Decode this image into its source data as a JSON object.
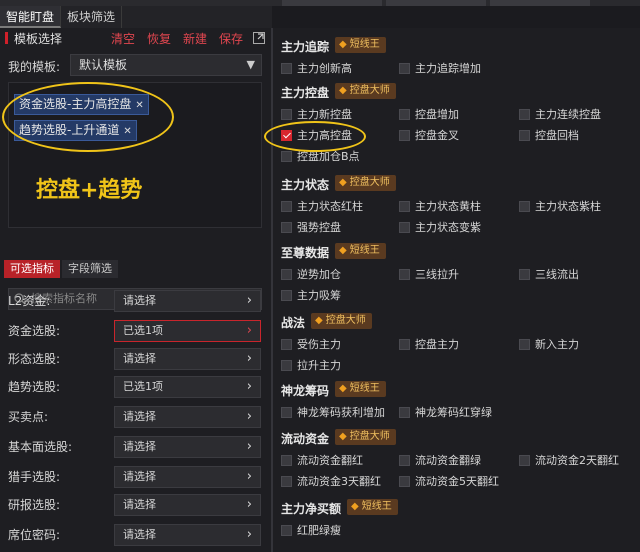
{
  "tabs": [
    "智能盯盘",
    "板块筛选"
  ],
  "left": {
    "header": {
      "title": "模板选择",
      "actions": [
        "清空",
        "恢复",
        "新建",
        "保存"
      ]
    },
    "my_template_label": "我的模板:",
    "template_value": "默认模板",
    "tags": [
      "资金选股-主力高控盘",
      "趋势选股-上升通道"
    ],
    "annotation": "控盘+趋势",
    "subtabs": [
      "可选指标",
      "字段筛选"
    ],
    "search_placeholder": "搜索指标名称",
    "filters": [
      {
        "label": "L2资金:",
        "value": "请选择"
      },
      {
        "label": "资金选股:",
        "value": "已选1项"
      },
      {
        "label": "形态选股:",
        "value": "请选择"
      },
      {
        "label": "趋势选股:",
        "value": "已选1项"
      },
      {
        "label": "买卖点:",
        "value": "请选择"
      },
      {
        "label": "基本面选股:",
        "value": "请选择"
      },
      {
        "label": "猎手选股:",
        "value": "请选择"
      },
      {
        "label": "研报选股:",
        "value": "请选择"
      },
      {
        "label": "席位密码:",
        "value": "请选择"
      }
    ]
  },
  "right": {
    "sections": [
      {
        "title": "主力追踪",
        "badge": "短线王",
        "items": [
          "主力创新高",
          "主力追踪增加"
        ]
      },
      {
        "title": "主力控盘",
        "badge": "控盘大师",
        "items": [
          "主力新控盘",
          "控盘增加",
          "主力连续控盘",
          "主力高控盘",
          "控盘金叉",
          "控盘回档",
          "控盘加仓B点"
        ]
      },
      {
        "title": "主力状态",
        "badge": "控盘大师",
        "items": [
          "主力状态红柱",
          "主力状态黄柱",
          "主力状态紫柱",
          "强势控盘",
          "主力状态变紫"
        ]
      },
      {
        "title": "至尊数据",
        "badge": "短线王",
        "items": [
          "逆势加仓",
          "三线拉升",
          "三线流出",
          "主力吸筹"
        ]
      },
      {
        "title": "战法",
        "badge": "控盘大师",
        "items": [
          "受伤主力",
          "控盘主力",
          "新入主力",
          "拉升主力"
        ]
      },
      {
        "title": "神龙筹码",
        "badge": "短线王",
        "items": [
          "神龙筹码获利增加",
          "神龙筹码红穿绿"
        ]
      },
      {
        "title": "流动资金",
        "badge": "控盘大师",
        "items": [
          "流动资金翻红",
          "流动资金翻绿",
          "流动资金2天翻红",
          "流动资金3天翻红",
          "流动资金5天翻红"
        ]
      },
      {
        "title": "主力净买额",
        "badge": "短线王",
        "items": [
          "红肥绿瘦"
        ]
      }
    ],
    "checked_item": "主力高控盘"
  }
}
